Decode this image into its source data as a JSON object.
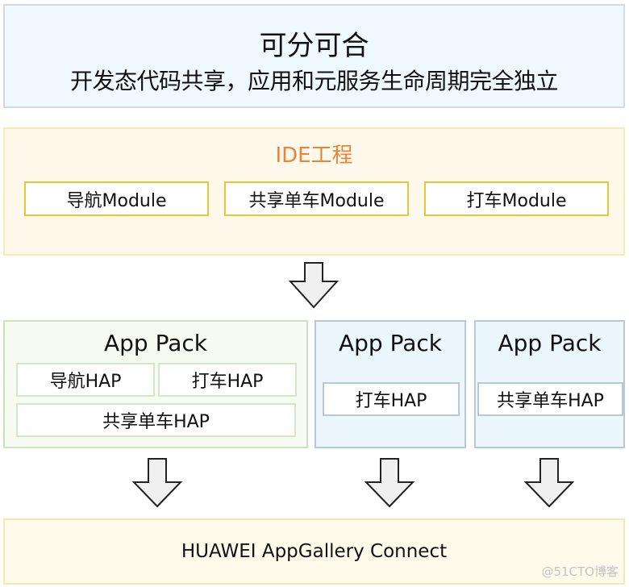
{
  "header": {
    "title": "可分可合",
    "subtitle": "开发态代码共享，应用和元服务生命周期完全独立"
  },
  "ide": {
    "title": "IDE工程",
    "title_color": "#e8853b",
    "modules": [
      {
        "label": "导航Module"
      },
      {
        "label": "共享单车Module"
      },
      {
        "label": "打车Module"
      }
    ]
  },
  "packs": [
    {
      "title": "App Pack",
      "haps": [
        {
          "label": "导航HAP"
        },
        {
          "label": "打车HAP"
        },
        {
          "label": "共享单车HAP"
        }
      ]
    },
    {
      "title": "App Pack",
      "haps": [
        {
          "label": "打车HAP"
        }
      ]
    },
    {
      "title": "App Pack",
      "haps": [
        {
          "label": "共享单车HAP"
        }
      ]
    }
  ],
  "arrows": [
    {
      "icon": "arrow-down-icon",
      "from": "IDE工程",
      "to": "App Pack"
    },
    {
      "icon": "arrow-down-icon",
      "from": "App Pack 1",
      "to": "HUAWEI AppGallery Connect"
    },
    {
      "icon": "arrow-down-icon",
      "from": "App Pack 2",
      "to": "HUAWEI AppGallery Connect"
    },
    {
      "icon": "arrow-down-icon",
      "from": "App Pack 3",
      "to": "HUAWEI AppGallery Connect"
    }
  ],
  "destination": {
    "label": "HUAWEI AppGallery Connect"
  },
  "watermark": "@51CTO博客"
}
